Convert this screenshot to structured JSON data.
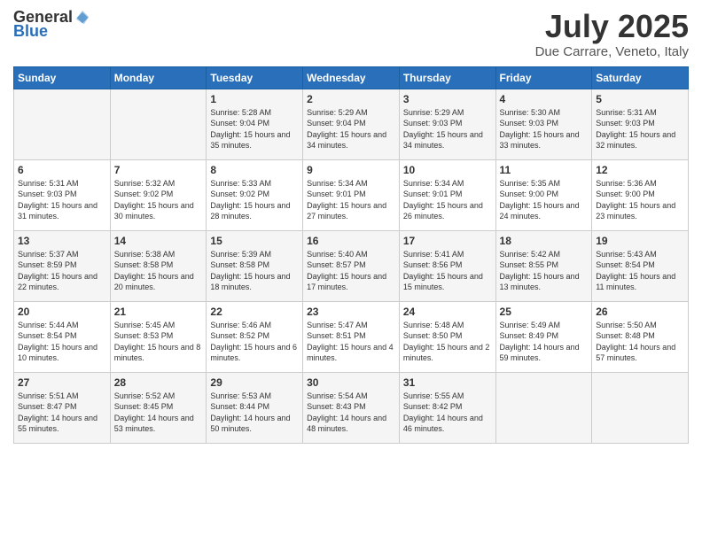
{
  "logo": {
    "general": "General",
    "blue": "Blue"
  },
  "title": {
    "month": "July 2025",
    "location": "Due Carrare, Veneto, Italy"
  },
  "days_of_week": [
    "Sunday",
    "Monday",
    "Tuesday",
    "Wednesday",
    "Thursday",
    "Friday",
    "Saturday"
  ],
  "weeks": [
    [
      {
        "day": null
      },
      {
        "day": null
      },
      {
        "day": "1",
        "sunrise": "5:28 AM",
        "sunset": "9:04 PM",
        "daylight": "15 hours and 35 minutes."
      },
      {
        "day": "2",
        "sunrise": "5:29 AM",
        "sunset": "9:04 PM",
        "daylight": "15 hours and 34 minutes."
      },
      {
        "day": "3",
        "sunrise": "5:29 AM",
        "sunset": "9:03 PM",
        "daylight": "15 hours and 34 minutes."
      },
      {
        "day": "4",
        "sunrise": "5:30 AM",
        "sunset": "9:03 PM",
        "daylight": "15 hours and 33 minutes."
      },
      {
        "day": "5",
        "sunrise": "5:31 AM",
        "sunset": "9:03 PM",
        "daylight": "15 hours and 32 minutes."
      }
    ],
    [
      {
        "day": "6",
        "sunrise": "5:31 AM",
        "sunset": "9:03 PM",
        "daylight": "15 hours and 31 minutes."
      },
      {
        "day": "7",
        "sunrise": "5:32 AM",
        "sunset": "9:02 PM",
        "daylight": "15 hours and 30 minutes."
      },
      {
        "day": "8",
        "sunrise": "5:33 AM",
        "sunset": "9:02 PM",
        "daylight": "15 hours and 28 minutes."
      },
      {
        "day": "9",
        "sunrise": "5:34 AM",
        "sunset": "9:01 PM",
        "daylight": "15 hours and 27 minutes."
      },
      {
        "day": "10",
        "sunrise": "5:34 AM",
        "sunset": "9:01 PM",
        "daylight": "15 hours and 26 minutes."
      },
      {
        "day": "11",
        "sunrise": "5:35 AM",
        "sunset": "9:00 PM",
        "daylight": "15 hours and 24 minutes."
      },
      {
        "day": "12",
        "sunrise": "5:36 AM",
        "sunset": "9:00 PM",
        "daylight": "15 hours and 23 minutes."
      }
    ],
    [
      {
        "day": "13",
        "sunrise": "5:37 AM",
        "sunset": "8:59 PM",
        "daylight": "15 hours and 22 minutes."
      },
      {
        "day": "14",
        "sunrise": "5:38 AM",
        "sunset": "8:58 PM",
        "daylight": "15 hours and 20 minutes."
      },
      {
        "day": "15",
        "sunrise": "5:39 AM",
        "sunset": "8:58 PM",
        "daylight": "15 hours and 18 minutes."
      },
      {
        "day": "16",
        "sunrise": "5:40 AM",
        "sunset": "8:57 PM",
        "daylight": "15 hours and 17 minutes."
      },
      {
        "day": "17",
        "sunrise": "5:41 AM",
        "sunset": "8:56 PM",
        "daylight": "15 hours and 15 minutes."
      },
      {
        "day": "18",
        "sunrise": "5:42 AM",
        "sunset": "8:55 PM",
        "daylight": "15 hours and 13 minutes."
      },
      {
        "day": "19",
        "sunrise": "5:43 AM",
        "sunset": "8:54 PM",
        "daylight": "15 hours and 11 minutes."
      }
    ],
    [
      {
        "day": "20",
        "sunrise": "5:44 AM",
        "sunset": "8:54 PM",
        "daylight": "15 hours and 10 minutes."
      },
      {
        "day": "21",
        "sunrise": "5:45 AM",
        "sunset": "8:53 PM",
        "daylight": "15 hours and 8 minutes."
      },
      {
        "day": "22",
        "sunrise": "5:46 AM",
        "sunset": "8:52 PM",
        "daylight": "15 hours and 6 minutes."
      },
      {
        "day": "23",
        "sunrise": "5:47 AM",
        "sunset": "8:51 PM",
        "daylight": "15 hours and 4 minutes."
      },
      {
        "day": "24",
        "sunrise": "5:48 AM",
        "sunset": "8:50 PM",
        "daylight": "15 hours and 2 minutes."
      },
      {
        "day": "25",
        "sunrise": "5:49 AM",
        "sunset": "8:49 PM",
        "daylight": "14 hours and 59 minutes."
      },
      {
        "day": "26",
        "sunrise": "5:50 AM",
        "sunset": "8:48 PM",
        "daylight": "14 hours and 57 minutes."
      }
    ],
    [
      {
        "day": "27",
        "sunrise": "5:51 AM",
        "sunset": "8:47 PM",
        "daylight": "14 hours and 55 minutes."
      },
      {
        "day": "28",
        "sunrise": "5:52 AM",
        "sunset": "8:45 PM",
        "daylight": "14 hours and 53 minutes."
      },
      {
        "day": "29",
        "sunrise": "5:53 AM",
        "sunset": "8:44 PM",
        "daylight": "14 hours and 50 minutes."
      },
      {
        "day": "30",
        "sunrise": "5:54 AM",
        "sunset": "8:43 PM",
        "daylight": "14 hours and 48 minutes."
      },
      {
        "day": "31",
        "sunrise": "5:55 AM",
        "sunset": "8:42 PM",
        "daylight": "14 hours and 46 minutes."
      },
      {
        "day": null
      },
      {
        "day": null
      }
    ]
  ]
}
